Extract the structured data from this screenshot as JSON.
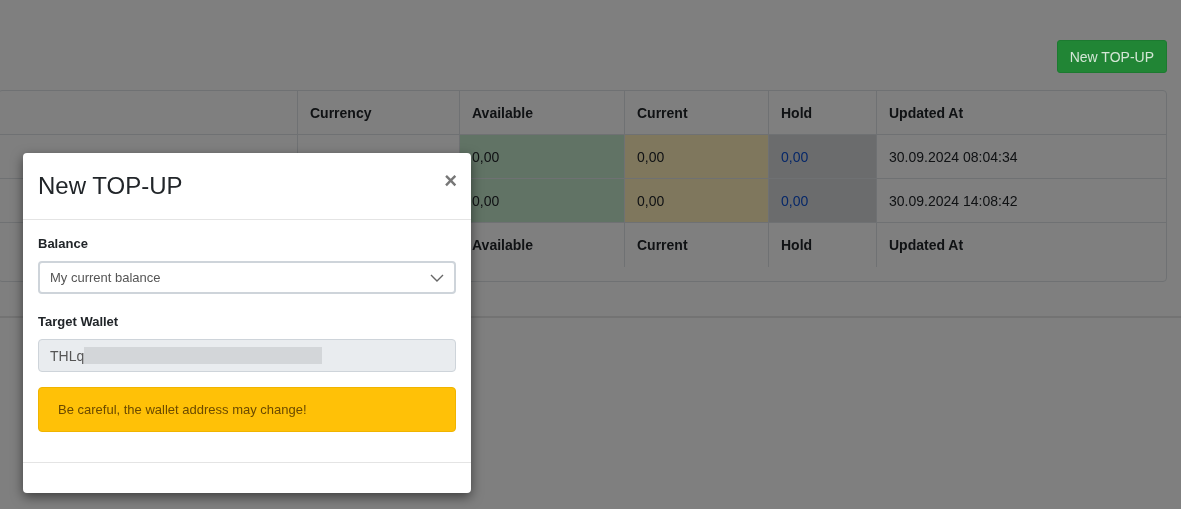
{
  "header_button": {
    "label": "New TOP-UP"
  },
  "table": {
    "columns": [
      {
        "kind": "plain"
      },
      {
        "label": "Currency",
        "kind": "plain"
      },
      {
        "label": "Available",
        "kind": "success"
      },
      {
        "label": "Current",
        "kind": "warning"
      },
      {
        "label": "Hold",
        "kind": "secondary"
      },
      {
        "label": "Updated At",
        "kind": "plain"
      }
    ],
    "rows": [
      {
        "cells": [
          "",
          "",
          "0,00",
          "0,00",
          "0,00",
          "30.09.2024 08:04:34"
        ]
      },
      {
        "cells": [
          "",
          "",
          "0,00",
          "0,00",
          "0,00",
          "30.09.2024 14:08:42"
        ]
      }
    ],
    "footer": [
      "Available",
      "Current",
      "Hold",
      "Updated At"
    ]
  },
  "modal": {
    "title": "New TOP-UP",
    "close": "×",
    "fields": [
      {
        "kind": "select",
        "label": "Balance",
        "value": "My current balance"
      },
      {
        "kind": "readonly",
        "label": "Target Wallet",
        "value": "THLq",
        "redacted": true
      }
    ],
    "alert": {
      "kind": "warning",
      "text": "Be careful, the wallet address may change!"
    }
  }
}
